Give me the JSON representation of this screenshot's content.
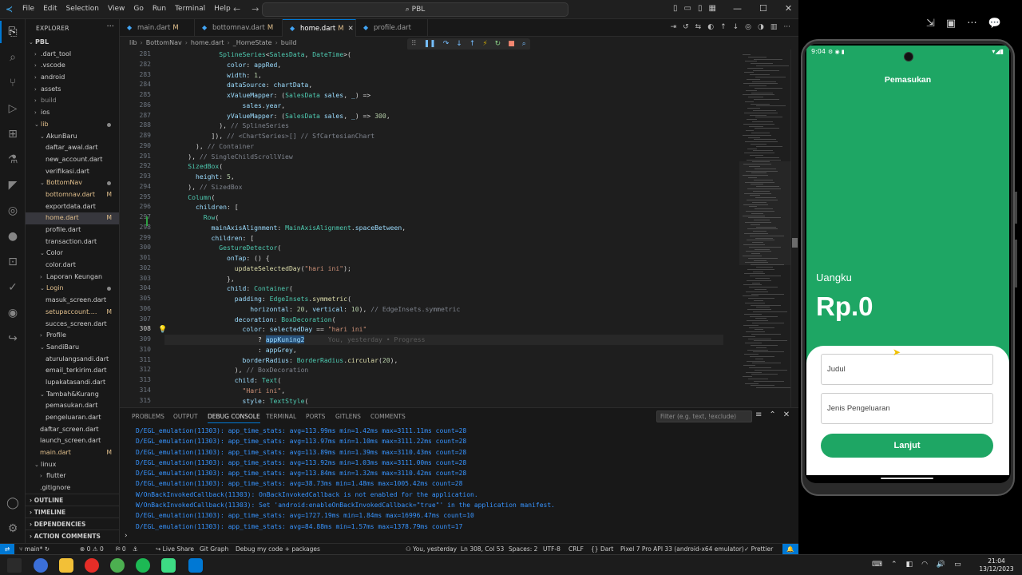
{
  "vscode": {
    "menu": [
      "File",
      "Edit",
      "Selection",
      "View",
      "Go",
      "Run",
      "Terminal",
      "Help"
    ],
    "search": "PBL",
    "explorer_title": "EXPLORER",
    "tree": [
      {
        "label": "PBL",
        "depth": 0,
        "chev": "v",
        "bold": true
      },
      {
        "label": ".dart_tool",
        "depth": 1,
        "chev": ">"
      },
      {
        "label": ".vscode",
        "depth": 1,
        "chev": ">"
      },
      {
        "label": "android",
        "depth": 1,
        "chev": ">"
      },
      {
        "label": "assets",
        "depth": 1,
        "chev": ">"
      },
      {
        "label": "build",
        "depth": 1,
        "chev": ">",
        "dim": true
      },
      {
        "label": "ios",
        "depth": 1,
        "chev": ">"
      },
      {
        "label": "lib",
        "depth": 1,
        "chev": "v",
        "dot": true,
        "mod": true
      },
      {
        "label": "AkunBaru",
        "depth": 2,
        "chev": "v"
      },
      {
        "label": "daftar_awal.dart",
        "depth": 3
      },
      {
        "label": "new_account.dart",
        "depth": 3
      },
      {
        "label": "verifikasi.dart",
        "depth": 3
      },
      {
        "label": "BottomNav",
        "depth": 2,
        "chev": "v",
        "dot": true,
        "mod": true
      },
      {
        "label": "bottomnav.dart",
        "depth": 3,
        "mark": "M",
        "mod": true
      },
      {
        "label": "exportdata.dart",
        "depth": 3
      },
      {
        "label": "home.dart",
        "depth": 3,
        "mark": "M",
        "mod": true,
        "selected": true
      },
      {
        "label": "profile.dart",
        "depth": 3
      },
      {
        "label": "transaction.dart",
        "depth": 3
      },
      {
        "label": "Color",
        "depth": 2,
        "chev": "v"
      },
      {
        "label": "color.dart",
        "depth": 3
      },
      {
        "label": "Laporan Keungan",
        "depth": 2,
        "chev": ">"
      },
      {
        "label": "Login",
        "depth": 2,
        "chev": "v",
        "dot": true,
        "mod": true
      },
      {
        "label": "masuk_screen.dart",
        "depth": 3
      },
      {
        "label": "setupaccount....",
        "depth": 3,
        "mark": "M",
        "mod": true
      },
      {
        "label": "succes_screen.dart",
        "depth": 3
      },
      {
        "label": "Profile",
        "depth": 2,
        "chev": ">"
      },
      {
        "label": "SandiBaru",
        "depth": 2,
        "chev": "v"
      },
      {
        "label": "aturulangsandi.dart",
        "depth": 3
      },
      {
        "label": "email_terkirim.dart",
        "depth": 3
      },
      {
        "label": "lupakatasandi.dart",
        "depth": 3
      },
      {
        "label": "Tambah&Kurang",
        "depth": 2,
        "chev": "v"
      },
      {
        "label": "pemasukan.dart",
        "depth": 3
      },
      {
        "label": "pengeluaran.dart",
        "depth": 3
      },
      {
        "label": "daftar_screen.dart",
        "depth": 2
      },
      {
        "label": "launch_screen.dart",
        "depth": 2
      },
      {
        "label": "main.dart",
        "depth": 2,
        "mark": "M",
        "mod": true
      },
      {
        "label": "linux",
        "depth": 1,
        "chev": "v"
      },
      {
        "label": "flutter",
        "depth": 2,
        "chev": ">"
      },
      {
        "label": ".gitignore",
        "depth": 2
      }
    ],
    "sections": [
      "OUTLINE",
      "TIMELINE",
      "DEPENDENCIES",
      "ACTION COMMENTS"
    ],
    "tabs": [
      {
        "label": "main.dart",
        "mark": "M"
      },
      {
        "label": "bottomnav.dart",
        "mark": "M"
      },
      {
        "label": "home.dart",
        "mark": "M",
        "active": true
      },
      {
        "label": "profile.dart",
        "mark": ""
      }
    ],
    "breadcrumb": [
      "lib",
      "BottomNav",
      "home.dart",
      "_HomeState",
      "build"
    ],
    "line_numbers": [
      "281",
      "282",
      "283",
      "284",
      "285",
      "286",
      "287",
      "288",
      "289",
      "290",
      "291",
      "292",
      "293",
      "294",
      "295",
      "296",
      "297",
      "298",
      "299",
      "300",
      "301",
      "302",
      "303",
      "304",
      "305",
      "306",
      "307",
      "308",
      "309",
      "310",
      "311",
      "312",
      "313",
      "314",
      "315"
    ],
    "current_line": "308",
    "blame": "You, yesterday • Progress",
    "panel_tabs": [
      "PROBLEMS",
      "OUTPUT",
      "DEBUG CONSOLE",
      "TERMINAL",
      "PORTS",
      "GITLENS",
      "COMMENTS"
    ],
    "panel_active": "DEBUG CONSOLE",
    "filter_placeholder": "Filter (e.g. text, !exclude)",
    "console": [
      "D/EGL_emulation(11303): app_time_stats: avg=113.99ms min=1.42ms max=3111.11ms count=28",
      "D/EGL_emulation(11303): app_time_stats: avg=113.97ms min=1.10ms max=3111.22ms count=28",
      "D/EGL_emulation(11303): app_time_stats: avg=113.89ms min=1.39ms max=3110.43ms count=28",
      "D/EGL_emulation(11303): app_time_stats: avg=113.92ms min=1.03ms max=3111.00ms count=28",
      "D/EGL_emulation(11303): app_time_stats: avg=113.84ms min=1.32ms max=3110.42ms count=28",
      "D/EGL_emulation(11303): app_time_stats: avg=38.73ms min=1.48ms max=1005.42ms count=28",
      "W/OnBackInvokedCallback(11303): OnBackInvokedCallback is not enabled for the application.",
      "W/OnBackInvokedCallback(11303): Set 'android:enableOnBackInvokedCallback=\"true\"' in the application manifest.",
      "D/EGL_emulation(11303): app_time_stats: avg=1727.19ms min=1.84ms max=16996.47ms count=10",
      "D/EGL_emulation(11303): app_time_stats: avg=84.88ms min=1.57ms max=1378.79ms count=17"
    ],
    "status": {
      "branch": "main*",
      "errors": "0",
      "warnings": "0",
      "ports": "0",
      "live_share": "Live Share",
      "git_graph": "Git Graph",
      "debug": "Debug my code + packages",
      "blame": "You, yesterday",
      "position": "Ln 308, Col 53",
      "spaces": "Spaces: 2",
      "encoding": "UTF-8",
      "eol": "CRLF",
      "language": "Dart",
      "device": "Pixel 7 Pro API 33 (android-x64 emulator)",
      "prettier": "Prettier"
    }
  },
  "phone": {
    "time": "9:04",
    "title": "Pemasukan",
    "balance_label": "Uangku",
    "balance": "Rp.0",
    "field1_placeholder": "Judul",
    "field2_placeholder": "Jenis Pengeluaran",
    "button": "Lanjut"
  },
  "taskbar": {
    "time": "21:04",
    "date": "13/12/2023"
  },
  "colors": {
    "accent": "#0078d4",
    "app_green": "#1ea664"
  }
}
